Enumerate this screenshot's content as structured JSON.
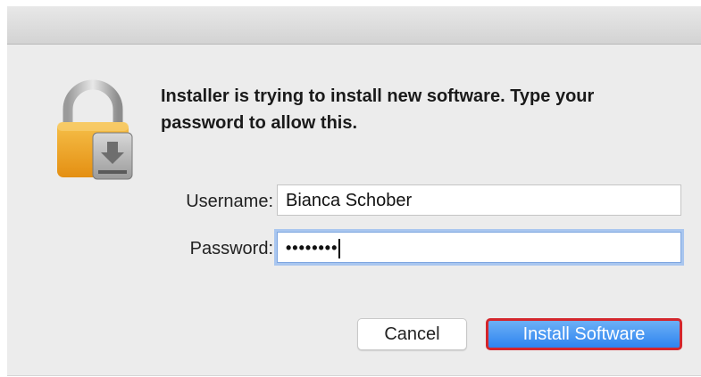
{
  "dialog": {
    "message": "Installer is trying to install new software. Type your password to allow this.",
    "icon": "lock-icon"
  },
  "form": {
    "username_label": "Username:",
    "username_value": "Bianca Schober",
    "password_label": "Password:",
    "password_masked": "••••••••"
  },
  "buttons": {
    "cancel_label": "Cancel",
    "install_label": "Install Software"
  },
  "colors": {
    "primary_button": "#2f84ef",
    "highlight_border": "#d4262c",
    "lock_body": "#f2a31f"
  }
}
